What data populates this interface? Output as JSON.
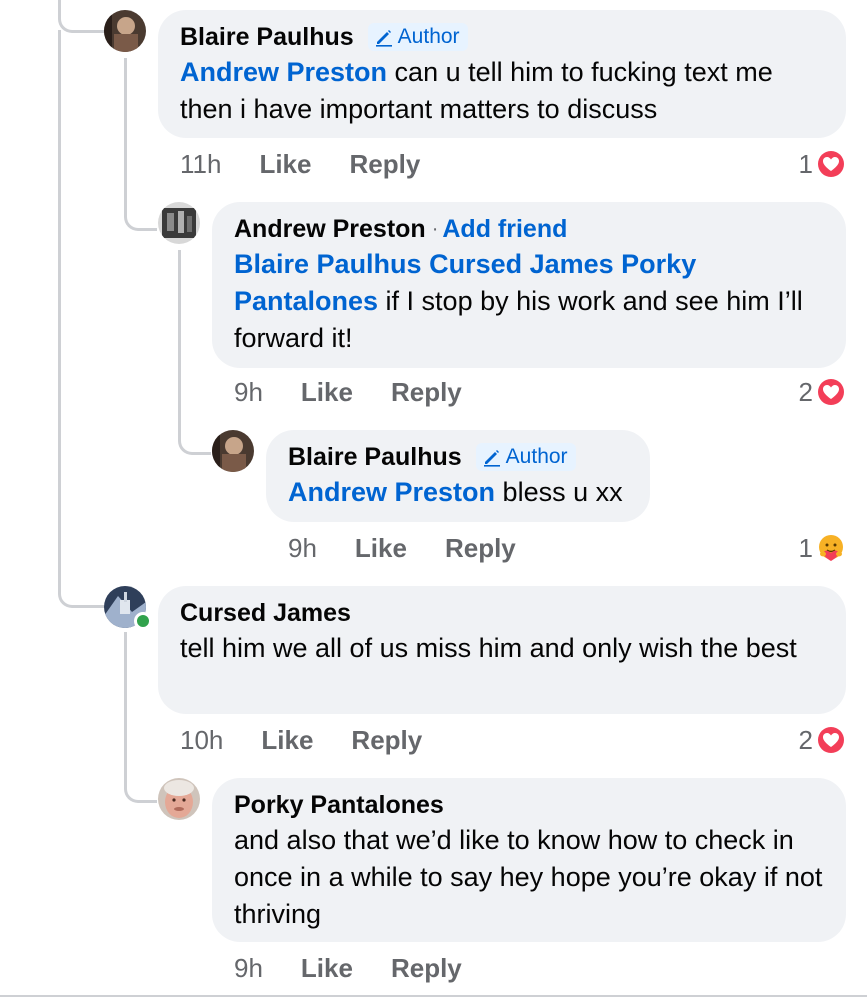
{
  "comments": [
    {
      "name": "Blaire Paulhus",
      "author_label": "Author",
      "mention": "Andrew Preston",
      "text": " can u tell him to fucking text me then i have important matters to discuss",
      "time": "11h",
      "like": "Like",
      "reply": "Reply",
      "reaction_count": "1",
      "reaction_icon": "heart-icon"
    },
    {
      "name": "Andrew Preston",
      "add_friend": "Add friend",
      "mention": "Blaire Paulhus Cursed James Porky Pantalones",
      "text": " if I stop by his work and see him I’ll forward it!",
      "time": "9h",
      "like": "Like",
      "reply": "Reply",
      "reaction_count": "2",
      "reaction_icon": "heart-icon"
    },
    {
      "name": "Blaire Paulhus",
      "author_label": "Author",
      "mention": "Andrew Preston",
      "text": " bless u xx",
      "time": "9h",
      "like": "Like",
      "reply": "Reply",
      "reaction_count": "1",
      "reaction_icon": "care-emoji-icon"
    },
    {
      "name": "Cursed James",
      "text": "tell him we all of us miss him and only wish the best",
      "time": "10h",
      "like": "Like",
      "reply": "Reply",
      "reaction_count": "2",
      "reaction_icon": "heart-icon",
      "online": true
    },
    {
      "name": "Porky Pantalones",
      "text": "and also that we’d like to know how to check in once in a while to say hey hope you’re okay if not thriving",
      "time": "9h",
      "like": "Like",
      "reply": "Reply"
    }
  ],
  "colors": {
    "bubble": "#f0f2f5",
    "link": "#0064d1",
    "meta": "#65676b",
    "heart": "#f33e58",
    "online": "#31a24c"
  }
}
